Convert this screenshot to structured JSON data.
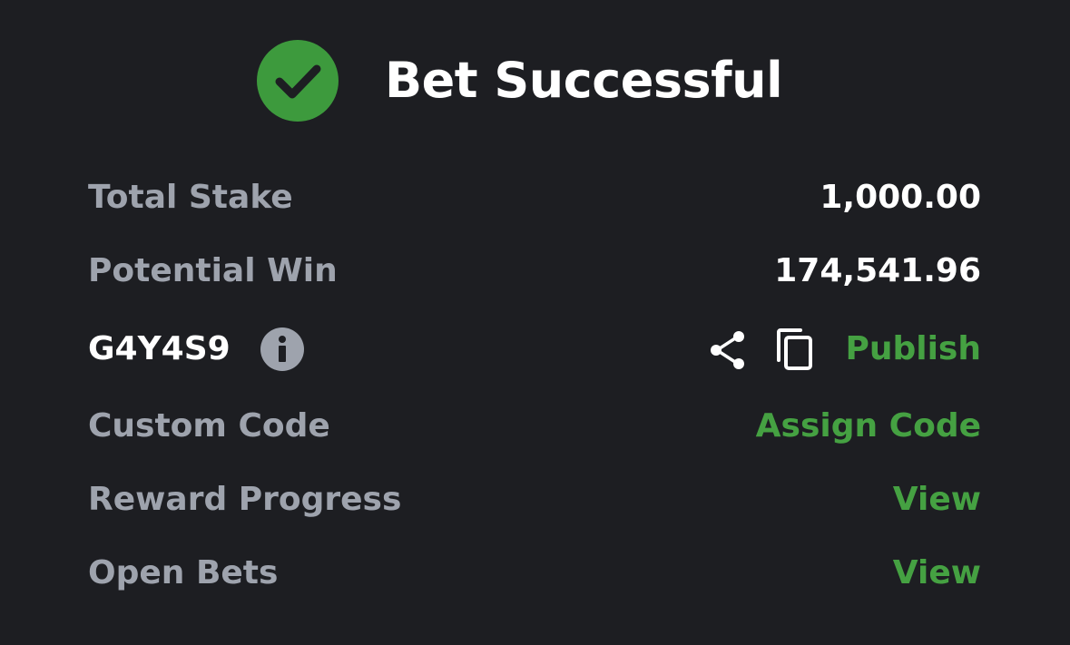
{
  "header": {
    "title": "Bet Successful",
    "icon": "check-circle-icon",
    "icon_color": "#3d9a3d"
  },
  "summary": {
    "total_stake": {
      "label": "Total Stake",
      "value": "1,000.00"
    },
    "potential_win": {
      "label": "Potential Win",
      "value": "174,541.96"
    },
    "booking_code": {
      "code": "G4Y4S9",
      "info_icon": "info-icon",
      "share_icon": "share-icon",
      "copy_icon": "copy-icon",
      "publish_label": "Publish"
    },
    "custom_code": {
      "label": "Custom Code",
      "action": "Assign Code"
    },
    "reward_progress": {
      "label": "Reward Progress",
      "action": "View"
    },
    "open_bets": {
      "label": "Open Bets",
      "action": "View"
    }
  },
  "colors": {
    "background": "#1d1e22",
    "label": "#9ea3ad",
    "value": "#ffffff",
    "accent": "#45a142"
  }
}
